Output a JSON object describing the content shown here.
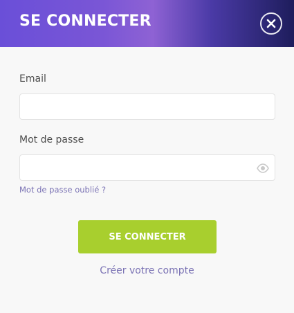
{
  "header": {
    "title": "SE CONNECTER",
    "close_icon": "close-icon"
  },
  "form": {
    "email_label": "Email",
    "email_value": "",
    "email_placeholder": "",
    "password_label": "Mot de passe",
    "password_value": "",
    "password_placeholder": "",
    "eye_icon": "eye-icon",
    "forgot_link": "Mot de passe oublié ?",
    "submit_label": "SE CONNECTER",
    "create_account_link": "Créer votre compte"
  },
  "colors": {
    "header_gradient": [
      "#6a4fd8",
      "#8e62d4",
      "#1e1d5c"
    ],
    "submit_button": "#a8cf2e",
    "link": "#7a72b4",
    "background": "#f8f8f8"
  }
}
